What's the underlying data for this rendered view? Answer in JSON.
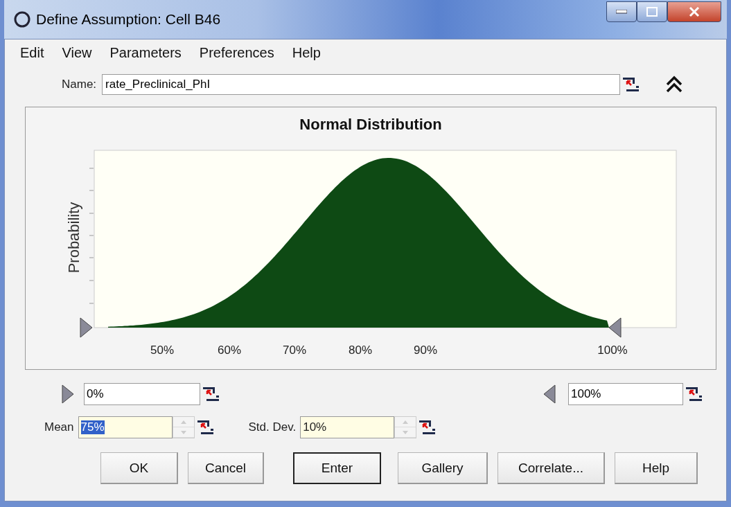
{
  "window": {
    "title": "Define Assumption: Cell B46"
  },
  "menu": [
    "Edit",
    "View",
    "Parameters",
    "Preferences",
    "Help"
  ],
  "name_field": {
    "label": "Name:",
    "value": "rate_Preclinical_PhI"
  },
  "chart": {
    "title": "Normal Distribution",
    "ylabel": "Probability",
    "xtick_labels": [
      "50%",
      "60%",
      "70%",
      "80%",
      "90%",
      "100%"
    ]
  },
  "min_field": {
    "value": "0%"
  },
  "max_field": {
    "value": "100%"
  },
  "parameters": [
    {
      "label": "Mean",
      "value": "75%",
      "selected": true
    },
    {
      "label": "Std. Dev.",
      "value": "10%",
      "selected": false
    }
  ],
  "buttons": [
    {
      "label": "OK",
      "default": false
    },
    {
      "label": "Cancel",
      "default": false
    },
    {
      "label": "Enter",
      "default": true
    },
    {
      "label": "Gallery",
      "default": false
    },
    {
      "label": "Correlate...",
      "default": false
    },
    {
      "label": "Help",
      "default": false
    }
  ]
}
